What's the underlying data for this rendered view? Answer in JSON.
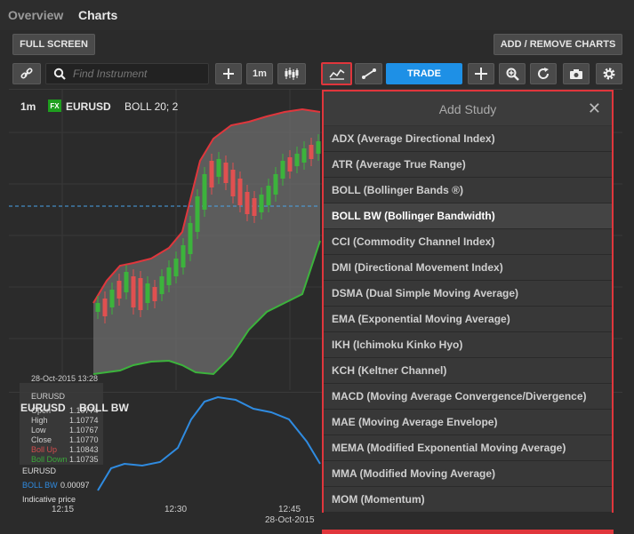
{
  "tabs": {
    "overview": "Overview",
    "charts": "Charts"
  },
  "toolbar": {
    "fullscreen": "FULL SCREEN",
    "add_remove": "ADD / REMOVE CHARTS",
    "search_placeholder": "Find Instrument",
    "interval": "1m",
    "trade": "TRADE"
  },
  "chart": {
    "interval": "1m",
    "badge": "FX",
    "symbol": "EURUSD",
    "study": "BOLL 20; 2",
    "sub_symbol": "EURUSD",
    "sub_study": "BOLL BW",
    "info": {
      "datetime": "28-Oct-2015 13:28",
      "symbol": "EURUSD",
      "rows": [
        {
          "label": "Open",
          "value": "1.10774"
        },
        {
          "label": "High",
          "value": "1.10774"
        },
        {
          "label": "Low",
          "value": "1.10767"
        },
        {
          "label": "Close",
          "value": "1.10770"
        },
        {
          "label": "Boll Up",
          "value": "1.10843"
        },
        {
          "label": "Boll Down",
          "value": "1.10735"
        }
      ]
    },
    "sub_info": {
      "symbol": "EURUSD",
      "label": "BOLL BW",
      "value": "0.00097",
      "note": "Indicative price"
    },
    "x_ticks": [
      "12:15",
      "12:30",
      "12:45"
    ],
    "date": "28-Oct-2015",
    "colors": {
      "up": "#3cb33c",
      "down": "#e05050",
      "boll": "#e0363c",
      "bw": "#2f8be0"
    }
  },
  "study_panel": {
    "title": "Add Study",
    "items": [
      "ADX (Average Directional Index)",
      "ATR (Average True Range)",
      "BOLL (Bollinger Bands ®)",
      "BOLL BW (Bollinger Bandwidth)",
      "CCI (Commodity Channel Index)",
      "DMI (Directional Movement Index)",
      "DSMA (Dual Simple Moving Average)",
      "EMA (Exponential Moving Average)",
      "IKH (Ichimoku Kinko Hyo)",
      "KCH (Keltner Channel)",
      "MACD (Moving Average Convergence/Divergence)",
      "MAE (Moving Average Envelope)",
      "MEMA (Modified Exponential Moving Average)",
      "MMA (Modified Moving Average)",
      "MOM (Momentum)"
    ],
    "selected_index": 3
  }
}
